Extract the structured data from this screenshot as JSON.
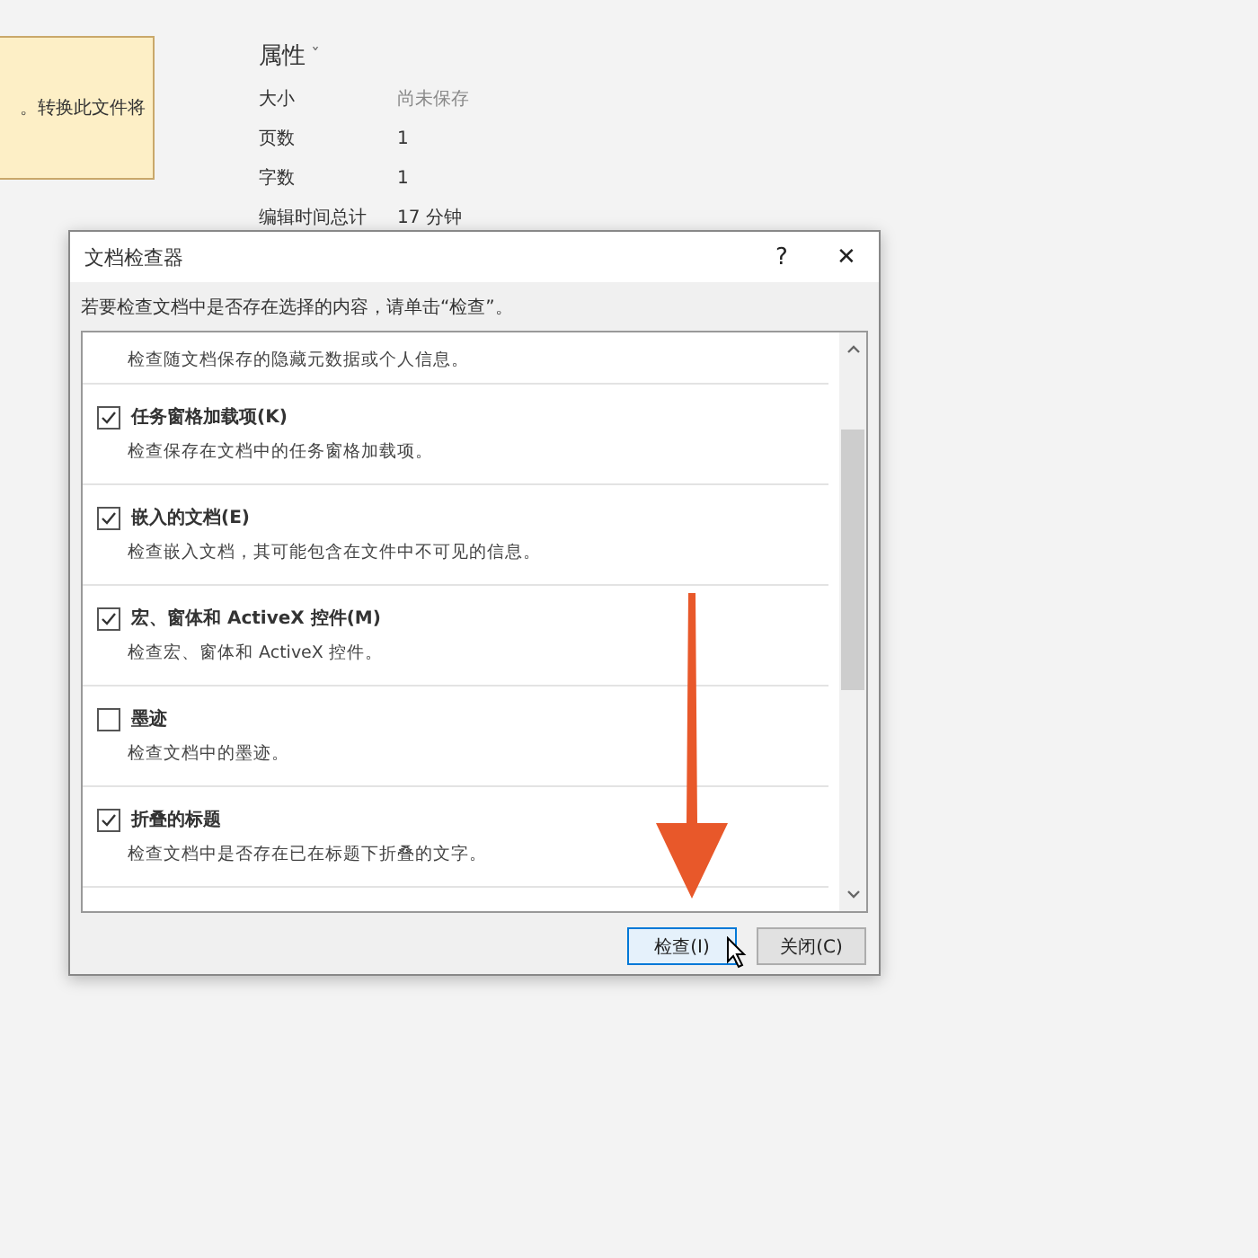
{
  "notice": {
    "text": "。转换此文件将"
  },
  "properties": {
    "title": "属性",
    "caret": "ˇ",
    "rows": [
      {
        "label": "大小",
        "value": "尚未保存",
        "muted": true
      },
      {
        "label": "页数",
        "value": "1",
        "muted": false
      },
      {
        "label": "字数",
        "value": "1",
        "muted": false
      },
      {
        "label": "编辑时间总计",
        "value": "17 分钟",
        "muted": false
      }
    ]
  },
  "dialog": {
    "title": "文档检查器",
    "help": "?",
    "close": "✕",
    "instruction": "若要检查文档中是否存在选择的内容，请单击“检查”。",
    "items": [
      {
        "description": "检查随文档保存的隐藏元数据或个人信息。"
      },
      {
        "label": "任务窗格加载项(K)",
        "checked": true,
        "description": "检查保存在文档中的任务窗格加载项。"
      },
      {
        "label": "嵌入的文档(E)",
        "checked": true,
        "description": "检查嵌入文档，其可能包含在文件中不可见的信息。"
      },
      {
        "label": "宏、窗体和 ActiveX 控件(M)",
        "checked": true,
        "description": "检查宏、窗体和 ActiveX 控件。"
      },
      {
        "label": "墨迹",
        "checked": false,
        "description": "检查文档中的墨迹。"
      },
      {
        "label": "折叠的标题",
        "checked": true,
        "description": "检查文档中是否存在已在标题下折叠的文字。"
      }
    ],
    "buttons": [
      {
        "label": "检查(I)",
        "selected": true
      },
      {
        "label": "关闭(C)",
        "selected": false
      }
    ]
  }
}
